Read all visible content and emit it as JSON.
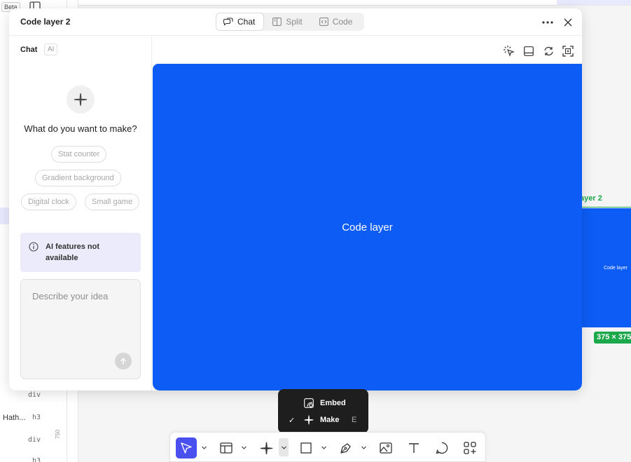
{
  "background": {
    "beta_badge": "Beta",
    "layers": [
      {
        "label": "div"
      },
      {
        "name": "Hath...",
        "label": "h3"
      },
      {
        "label": "div"
      },
      {
        "label": "h3"
      }
    ],
    "ruler_value": "750",
    "frame_label": "ayer 2",
    "frame_preview_text": "Code layer",
    "size_badge": "375 × 375"
  },
  "dialog": {
    "title": "Code layer 2",
    "view_tabs": [
      {
        "label": "Chat",
        "icon": "chat-bubbles-icon",
        "active": true
      },
      {
        "label": "Split",
        "icon": "columns-icon",
        "active": false
      },
      {
        "label": "Code",
        "icon": "code-icon",
        "active": false
      }
    ],
    "chat": {
      "title": "Chat",
      "badge": "AI",
      "question": "What do you want to make?",
      "suggestions": [
        "Stat counter",
        "Gradient background",
        "Digital clock",
        "Small game"
      ],
      "notice": "AI features not available",
      "input_placeholder": "Describe your idea"
    },
    "preview": {
      "label": "Code layer",
      "canvas_color": "#0d5cf5"
    }
  },
  "popover": {
    "items": [
      {
        "label": "Embed",
        "icon": "embed-icon",
        "checked": false,
        "shortcut": ""
      },
      {
        "label": "Make",
        "icon": "sparkle-icon",
        "checked": true,
        "shortcut": "E"
      }
    ]
  },
  "toolbar": {
    "accent": "#4a50f0",
    "tools": [
      "move-tool",
      "frame-tool",
      "make-tool",
      "rectangle-tool",
      "pen-tool",
      "image-tool",
      "text-tool",
      "comment-tool",
      "actions-tool"
    ]
  }
}
